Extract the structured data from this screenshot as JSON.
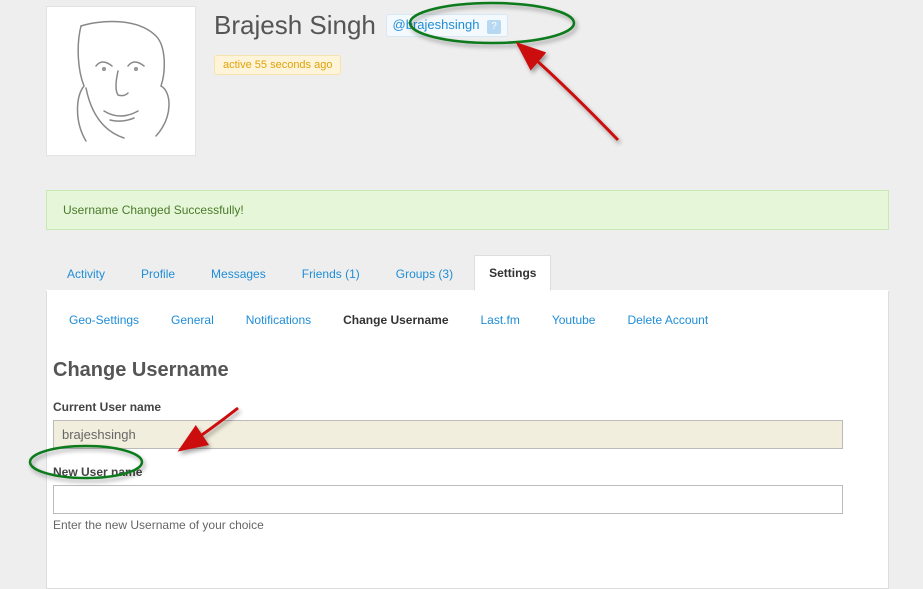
{
  "profile": {
    "display_name": "Brajesh Singh",
    "handle": "@brajeshsingh",
    "activity": "active 55 seconds ago"
  },
  "notice": {
    "success": "Username Changed Successfully!"
  },
  "tabs": {
    "activity": "Activity",
    "profile": "Profile",
    "messages": "Messages",
    "friends": "Friends (1)",
    "groups": "Groups (3)",
    "settings": "Settings"
  },
  "subtabs": {
    "geo": "Geo-Settings",
    "general": "General",
    "notifications": "Notifications",
    "change_username": "Change Username",
    "lastfm": "Last.fm",
    "youtube": "Youtube",
    "delete": "Delete Account"
  },
  "form": {
    "section_title": "Change Username",
    "current_label": "Current User name",
    "current_value": "brajeshsingh",
    "new_label": "New User name",
    "new_value": "",
    "new_hint": "Enter the new Username of your choice"
  }
}
